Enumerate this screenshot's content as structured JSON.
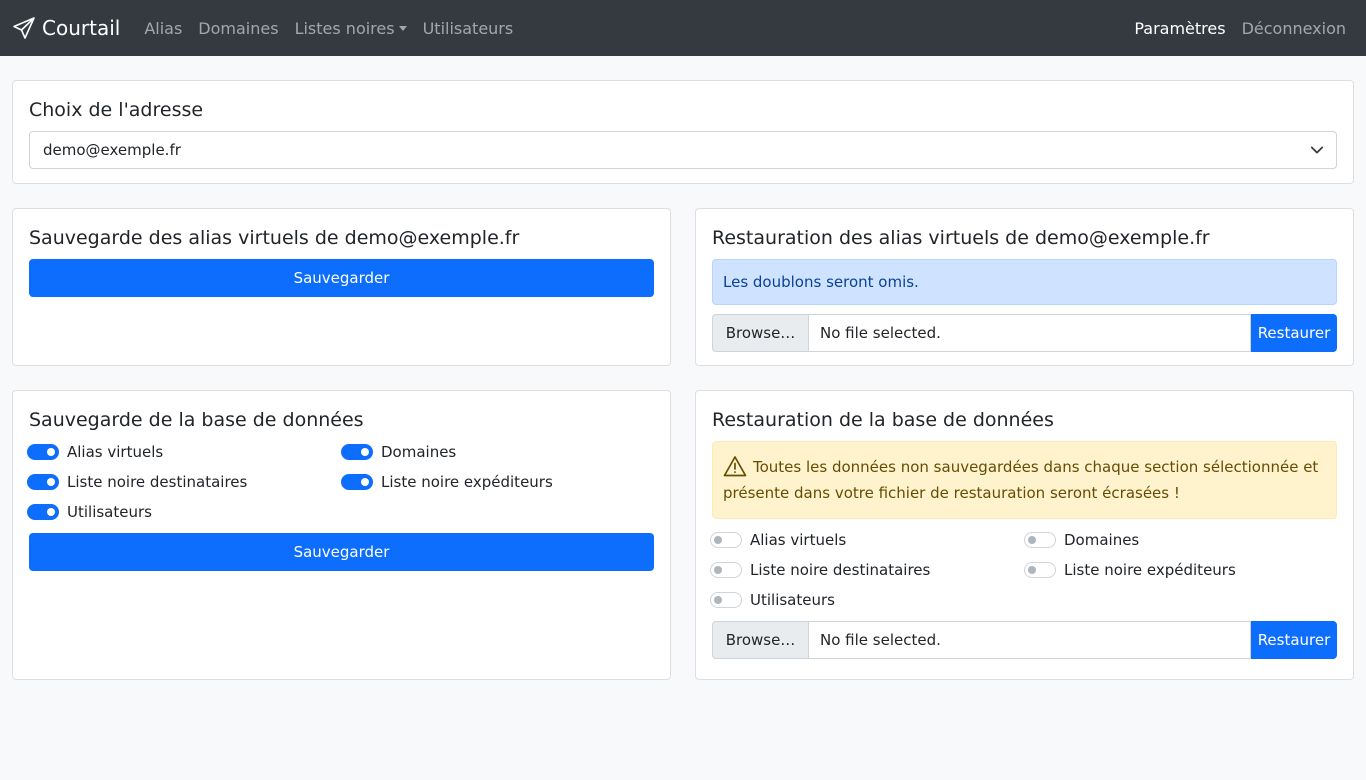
{
  "navbar": {
    "brand": "Courtail",
    "links": [
      "Alias",
      "Domaines",
      "Listes noires",
      "Utilisateurs"
    ],
    "settings": "Paramètres",
    "logout": "Déconnexion"
  },
  "address": {
    "title": "Choix de l'adresse",
    "selected": "demo@exemple.fr"
  },
  "alias_backup": {
    "title": "Sauvegarde des alias virtuels de demo@exemple.fr",
    "button": "Sauvegarder"
  },
  "alias_restore": {
    "title": "Restauration des alias virtuels de demo@exemple.fr",
    "info": "Les doublons seront omis.",
    "browse": "Browse…",
    "file": "No file selected.",
    "button": "Restaurer"
  },
  "db_backup": {
    "title": "Sauvegarde de la base de données",
    "switches": [
      {
        "label": "Alias virtuels",
        "checked": true
      },
      {
        "label": "Domaines",
        "checked": true
      },
      {
        "label": "Liste noire destinataires",
        "checked": true
      },
      {
        "label": "Liste noire expéditeurs",
        "checked": true
      },
      {
        "label": "Utilisateurs",
        "checked": true
      }
    ],
    "button": "Sauvegarder"
  },
  "db_restore": {
    "title": "Restauration de la base de données",
    "warning": "Toutes les données non sauvegardées dans chaque section sélectionnée et présente dans votre fichier de restauration seront écrasées !",
    "switches": [
      {
        "label": "Alias virtuels",
        "checked": false
      },
      {
        "label": "Domaines",
        "checked": false
      },
      {
        "label": "Liste noire destinataires",
        "checked": false
      },
      {
        "label": "Liste noire expéditeurs",
        "checked": false
      },
      {
        "label": "Utilisateurs",
        "checked": false
      }
    ],
    "browse": "Browse…",
    "file": "No file selected.",
    "button": "Restaurer"
  },
  "colors": {
    "navbar": "#343a40",
    "primary": "#0d6efd",
    "info_bg": "#cfe2ff",
    "warning_bg": "#fff3cd"
  }
}
